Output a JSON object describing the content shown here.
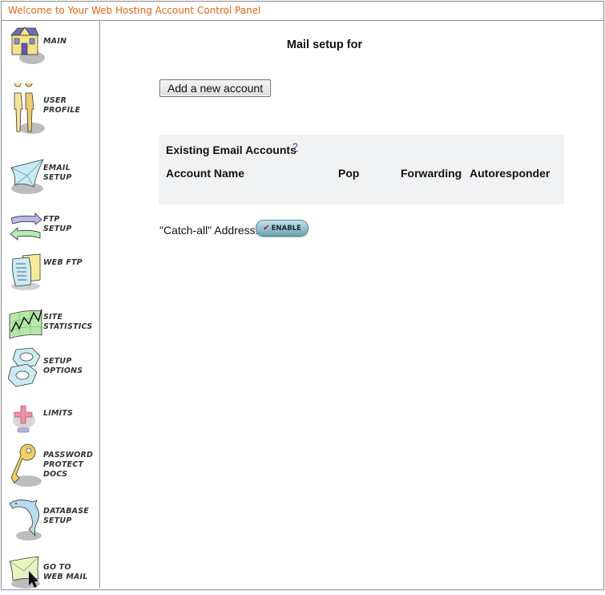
{
  "header": {
    "title": "Welcome to Your Web Hosting Account Control Panel"
  },
  "sidebar": {
    "items": [
      {
        "id": "main",
        "icon": "house-icon",
        "label_lines": [
          "MAIN"
        ]
      },
      {
        "id": "user-profile",
        "icon": "people-icon",
        "label_lines": [
          "USER",
          "PROFILE"
        ]
      },
      {
        "id": "email-setup",
        "icon": "envelope-icon",
        "label_lines": [
          "EMAIL",
          "SETUP"
        ]
      },
      {
        "id": "ftp-setup",
        "icon": "arrows-icon",
        "label_lines": [
          "FTP",
          "SETUP"
        ]
      },
      {
        "id": "web-ftp",
        "icon": "documents-icon",
        "label_lines": [
          "WEB FTP"
        ]
      },
      {
        "id": "site-statistics",
        "icon": "chart-icon",
        "label_lines": [
          "SITE",
          "STATISTICS"
        ]
      },
      {
        "id": "setup-options",
        "icon": "nuts-icon",
        "label_lines": [
          "SETUP",
          "OPTIONS"
        ]
      },
      {
        "id": "limits",
        "icon": "plus-minus-icon",
        "label_lines": [
          "LIMITS"
        ]
      },
      {
        "id": "password-protect-docs",
        "icon": "key-icon",
        "label_lines": [
          "PASSWORD",
          "PROTECT",
          "DOCS"
        ]
      },
      {
        "id": "database-setup",
        "icon": "dolphin-icon",
        "label_lines": [
          "DATABASE",
          "SETUP"
        ]
      },
      {
        "id": "go-to-web-mail",
        "icon": "mail-cursor-icon",
        "label_lines": [
          "GO TO",
          "WEB MAIL"
        ]
      }
    ]
  },
  "main": {
    "title": "Mail setup for",
    "add_account_label": "Add a new account",
    "accounts": {
      "title": "Existing Email Accounts",
      "help_label": "?",
      "columns": [
        "Account Name",
        "Pop",
        "Forwarding",
        "Autoresponder"
      ],
      "rows": []
    },
    "catchall": {
      "label": "\"Catch-all\" Address:",
      "button_label": "ENABLE",
      "button_icon": "checkmark-icon"
    }
  },
  "colors": {
    "header_text": "#e8620f",
    "border": "#8c8c8c",
    "panel_bg": "#f1f2f4",
    "help_link": "#5b2c8c"
  }
}
